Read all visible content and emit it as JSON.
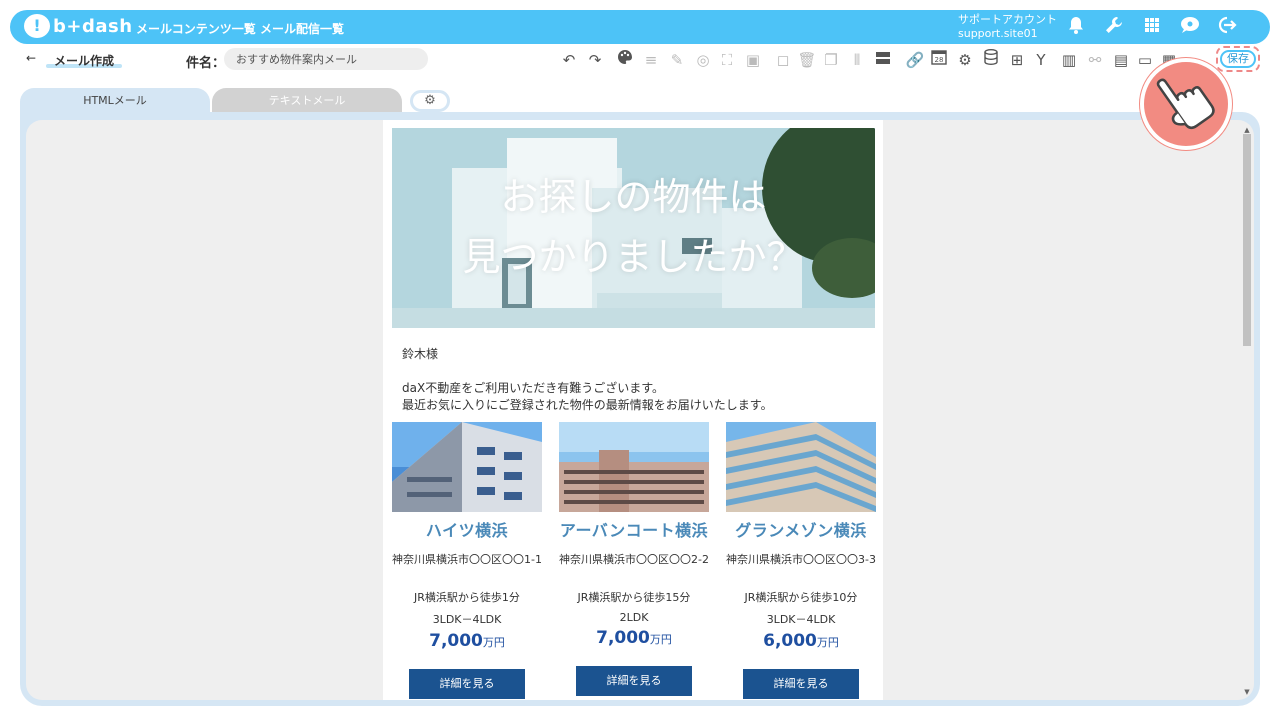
{
  "app": {
    "logo_mark": "!",
    "logo_text": "b+dash",
    "nav": [
      "メールコンテンツ一覧",
      "メール配信一覧"
    ],
    "account_label": "サポートアカウント",
    "account_id": "support.site01",
    "header_icons": [
      "bell-icon",
      "wrench-icon",
      "grid-icon",
      "chat-icon",
      "logout-icon"
    ],
    "accent_color": "#4dc3f7"
  },
  "toolbar": {
    "back_arrow": "←",
    "title": "メール作成",
    "subject_label": "件名：",
    "subject_value": "おすすめ物件案内メール",
    "save_label": "保存",
    "calendar_day": "28"
  },
  "tabs": {
    "html_label": "HTMLメール",
    "text_label": "テキストメール",
    "settings_icon": "gear-icon"
  },
  "email": {
    "hero_line1": "お探しの物件は",
    "hero_line2": "見つかりましたか？",
    "greeting": "鈴木様",
    "intro_line1": "daX不動産をご利用いただき有難うございます。",
    "intro_line2": "最近お気に入りにご登録された物件の最新情報をお届けいたします。",
    "properties": [
      {
        "name": "ハイツ横浜",
        "address": "神奈川県横浜市〇〇区〇〇1-1",
        "access": "JR横浜駅から徒歩1分",
        "layout": "3LDK－4LDK",
        "price": "7,000",
        "unit": "万円",
        "button": "詳細を見る"
      },
      {
        "name": "アーバンコート横浜",
        "address": "神奈川県横浜市〇〇区〇〇2-2",
        "access": "JR横浜駅から徒歩15分",
        "layout": "2LDK",
        "price": "7,000",
        "unit": "万円",
        "button": "詳細を見る"
      },
      {
        "name": "グランメゾン横浜",
        "address": "神奈川県横浜市〇〇区〇〇3-3",
        "access": "JR横浜駅から徒歩10分",
        "layout": "3LDK－4LDK",
        "price": "6,000",
        "unit": "万円",
        "button": "詳細を見る"
      }
    ]
  }
}
